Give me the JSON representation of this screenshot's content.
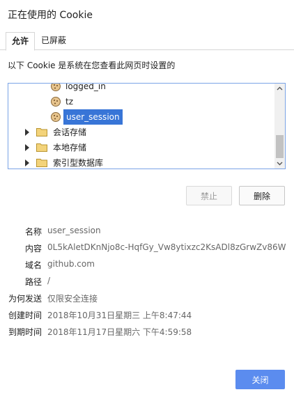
{
  "dialog": {
    "title": "正在使用的 Cookie"
  },
  "tabs": [
    {
      "label": "允许",
      "active": true
    },
    {
      "label": "已屏蔽",
      "active": false
    }
  ],
  "intro_text": "以下 Cookie 是系统在您查看此网页时设置的",
  "tree": {
    "cookies": [
      {
        "label": "logged_in",
        "icon": "cookie-icon"
      },
      {
        "label": "tz",
        "icon": "cookie-icon"
      },
      {
        "label": "user_session",
        "icon": "cookie-icon",
        "selected": true
      }
    ],
    "folders": [
      {
        "label": "会话存储",
        "icon": "folder-icon"
      },
      {
        "label": "本地存储",
        "icon": "folder-icon"
      },
      {
        "label": "索引型数据库",
        "icon": "folder-icon"
      }
    ]
  },
  "buttons": {
    "block": "禁止",
    "delete": "删除",
    "close": "关闭"
  },
  "details": [
    {
      "label": "名称",
      "value": "user_session"
    },
    {
      "label": "内容",
      "value": "0L5kAletDKnNjo8c-HqfGy_Vw8ytixzc2KsADl8zGrwZv86W"
    },
    {
      "label": "域名",
      "value": "github.com"
    },
    {
      "label": "路径",
      "value": "/"
    },
    {
      "label": "为何发送",
      "value": "仅限安全连接"
    },
    {
      "label": "创建时间",
      "value": "2018年10月31日星期三 上午8:47:44"
    },
    {
      "label": "到期时间",
      "value": "2018年11月17日星期六 下午4:59:58"
    }
  ],
  "colors": {
    "accent": "#5b8cef",
    "selection": "#3875d7",
    "tree_border": "#7aa3e6"
  }
}
